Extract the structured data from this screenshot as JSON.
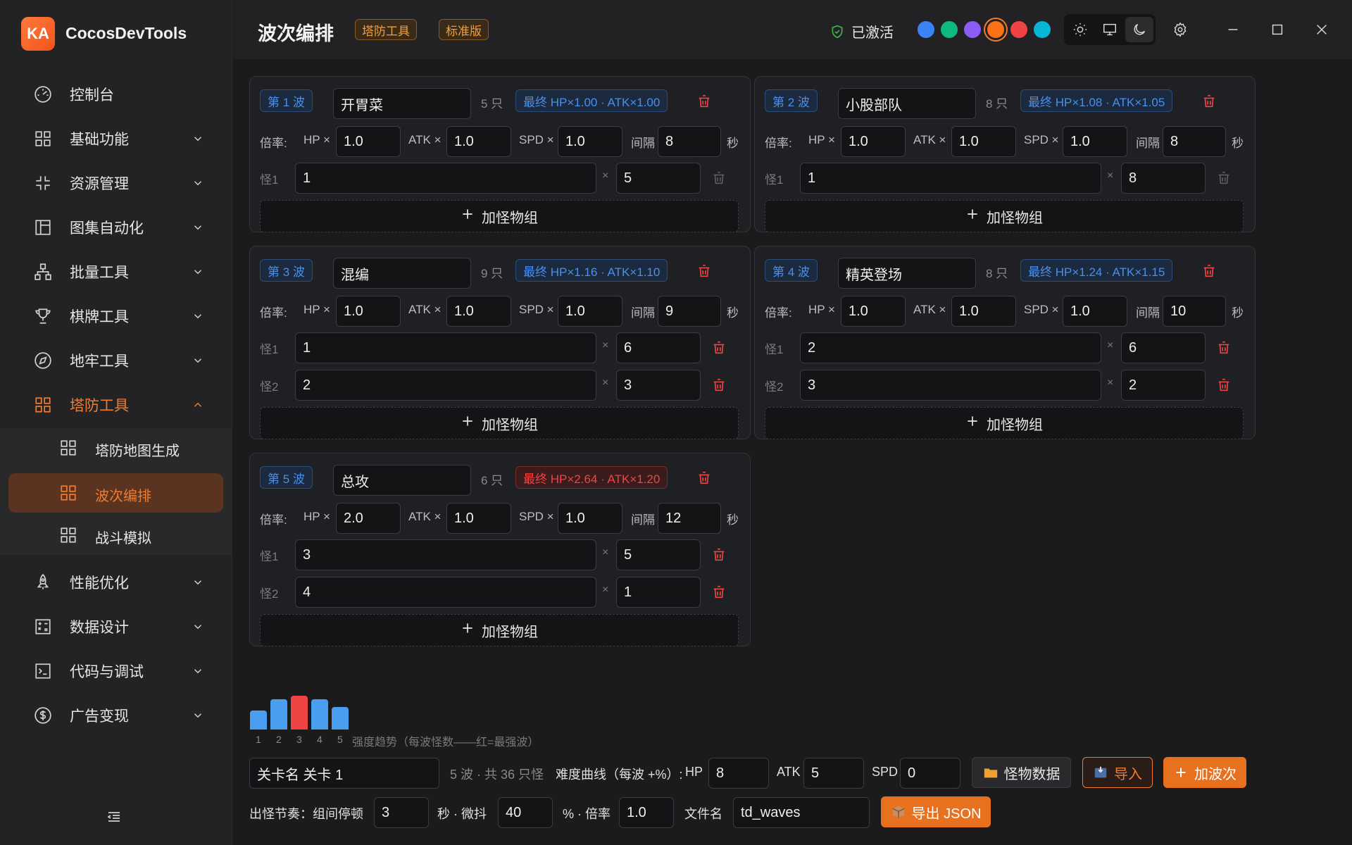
{
  "app": {
    "logo_text": "KA",
    "name": "CocosDevTools"
  },
  "sidebar": {
    "items": [
      {
        "label": "控制台",
        "icon": "gauge-icon"
      },
      {
        "label": "基础功能",
        "icon": "grid-icon"
      },
      {
        "label": "资源管理",
        "icon": "compress-icon"
      },
      {
        "label": "图集自动化",
        "icon": "layout-icon"
      },
      {
        "label": "批量工具",
        "icon": "network-icon"
      },
      {
        "label": "棋牌工具",
        "icon": "trophy-icon"
      },
      {
        "label": "地牢工具",
        "icon": "compass-icon"
      },
      {
        "label": "塔防工具",
        "icon": "grid-icon"
      },
      {
        "label": "性能优化",
        "icon": "rocket-icon"
      },
      {
        "label": "数据设计",
        "icon": "calculator-icon"
      },
      {
        "label": "代码与调试",
        "icon": "terminal-icon"
      },
      {
        "label": "广告变现",
        "icon": "dollar-icon"
      }
    ],
    "sub_items": [
      {
        "label": "塔防地图生成"
      },
      {
        "label": "波次编排"
      },
      {
        "label": "战斗模拟"
      }
    ],
    "active_section": "塔防工具",
    "selected_sub": "波次编排"
  },
  "header": {
    "title": "波次编排",
    "tags": [
      "塔防工具",
      "标准版"
    ],
    "activation": "已激活",
    "theme_colors": [
      "#3b82f6",
      "#10b981",
      "#8b5cf6",
      "#f97316",
      "#ef4444",
      "#06b6d4"
    ],
    "selected_color": "#f97316",
    "modes": [
      "light",
      "system",
      "dark"
    ],
    "selected_mode": "dark"
  },
  "labels": {
    "rate": "倍率:",
    "hp": "HP ×",
    "atk": "ATK ×",
    "spd": "SPD ×",
    "interval": "间隔",
    "sec": "秒",
    "times": "×",
    "add_group": "加怪物组"
  },
  "waves": [
    {
      "badge": "第 1 波",
      "name": "开胃菜",
      "count": "5 只",
      "final": "最终 HP×1.00 · ATK×1.00",
      "strongest": false,
      "hp": "1.0",
      "atk": "1.0",
      "spd": "1.0",
      "interval": "8",
      "groups": [
        {
          "label": "怪1",
          "monster": "1",
          "qty": "5"
        }
      ]
    },
    {
      "badge": "第 2 波",
      "name": "小股部队",
      "count": "8 只",
      "final": "最终 HP×1.08 · ATK×1.05",
      "strongest": false,
      "hp": "1.0",
      "atk": "1.0",
      "spd": "1.0",
      "interval": "8",
      "groups": [
        {
          "label": "怪1",
          "monster": "1",
          "qty": "8"
        }
      ]
    },
    {
      "badge": "第 3 波",
      "name": "混编",
      "count": "9 只",
      "final": "最终 HP×1.16 · ATK×1.10",
      "strongest": false,
      "hp": "1.0",
      "atk": "1.0",
      "spd": "1.0",
      "interval": "9",
      "groups": [
        {
          "label": "怪1",
          "monster": "1",
          "qty": "6"
        },
        {
          "label": "怪2",
          "monster": "2",
          "qty": "3"
        }
      ]
    },
    {
      "badge": "第 4 波",
      "name": "精英登场",
      "count": "8 只",
      "final": "最终 HP×1.24 · ATK×1.15",
      "strongest": false,
      "hp": "1.0",
      "atk": "1.0",
      "spd": "1.0",
      "interval": "10",
      "groups": [
        {
          "label": "怪1",
          "monster": "2",
          "qty": "6"
        },
        {
          "label": "怪2",
          "monster": "3",
          "qty": "2"
        }
      ]
    },
    {
      "badge": "第 5 波",
      "name": "总攻",
      "count": "6 只",
      "final": "最终 HP×2.64 · ATK×1.20",
      "strongest": true,
      "hp": "2.0",
      "atk": "1.0",
      "spd": "1.0",
      "interval": "12",
      "groups": [
        {
          "label": "怪1",
          "monster": "3",
          "qty": "5"
        },
        {
          "label": "怪2",
          "monster": "4",
          "qty": "1"
        }
      ]
    }
  ],
  "trend": {
    "caption": "强度趋势（每波怪数——红=最强波）",
    "labels": [
      "1",
      "2",
      "3",
      "4",
      "5"
    ],
    "values": [
      5,
      8,
      9,
      8,
      6
    ],
    "max_index": 2
  },
  "footer": {
    "level_name": "关卡名 关卡 1",
    "summary": "5 波 · 共 36 只怪",
    "difficulty_label": "难度曲线（每波 +%）:",
    "hp_label": "HP",
    "hp_value": "8",
    "atk_label": "ATK",
    "atk_value": "5",
    "spd_label": "SPD",
    "spd_value": "0",
    "monster_data_btn": "怪物数据",
    "import_btn": "导入",
    "add_wave_btn": "加波次",
    "rhythm_label": "出怪节奏：组间停顿",
    "pause_value": "3",
    "jitter_label": "秒 · 微抖",
    "jitter_value": "40",
    "rate_label": "% · 倍率",
    "rate_value": "1.0",
    "filename_label": "文件名",
    "filename_value": "td_waves",
    "export_btn": "导出 JSON"
  }
}
